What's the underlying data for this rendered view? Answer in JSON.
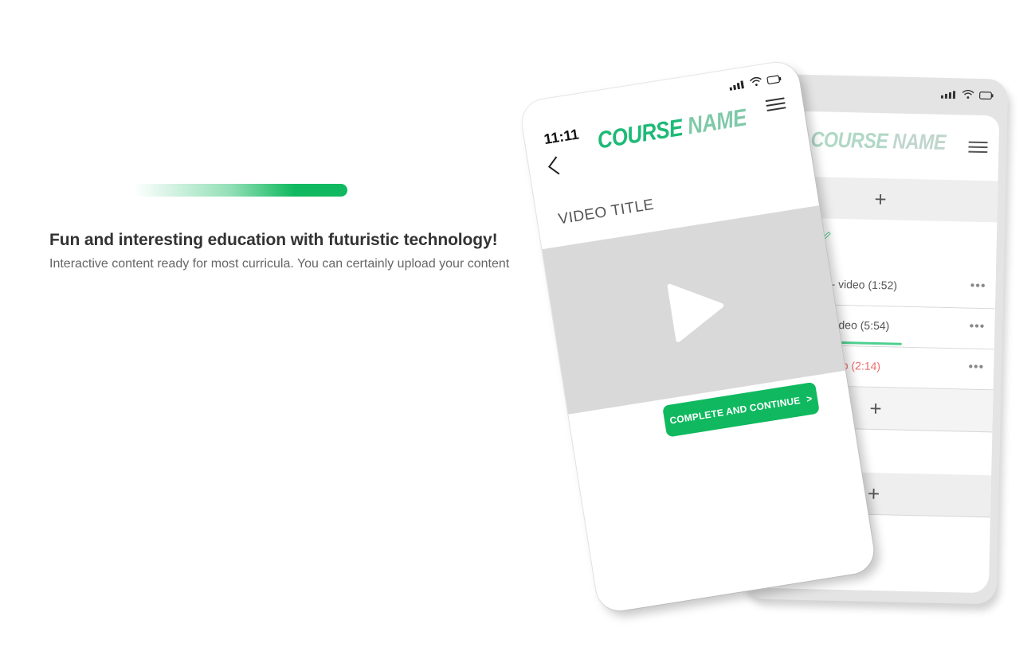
{
  "hero": {
    "title": "Fun and interesting education with futuristic technology!",
    "subtitle": "Interactive content ready for most curricula. You can certainly upload your content"
  },
  "front_phone": {
    "time": "11:11",
    "course_name_part1": "COURSE ",
    "course_name_part2": "NAME",
    "video_title": "VIDEO TITLE",
    "cta_label": "COMPLETE AND CONTINUE",
    "cta_chevron": ">"
  },
  "back_phone": {
    "course_name_part1": "COURSE ",
    "course_name_part2": "NAME",
    "add_symbol": "+",
    "lessons": [
      {
        "label": "- video  (1:52)",
        "more": "•••",
        "state": "normal"
      },
      {
        "label": "video  (5:54)",
        "more": "•••",
        "state": "in-progress",
        "progress": 0.6
      },
      {
        "label": "deo  (2:14)",
        "more": "•••",
        "state": "warning"
      }
    ]
  },
  "colors": {
    "brand_green": "#10b95f",
    "course_name_green": "#1dba77",
    "warning_red": "#ef6a6a"
  },
  "icons": [
    "signal-icon",
    "wifi-icon",
    "battery-icon",
    "menu-icon",
    "back-arrow-icon",
    "play-icon",
    "plus-icon",
    "pencil-icon",
    "more-icon"
  ]
}
